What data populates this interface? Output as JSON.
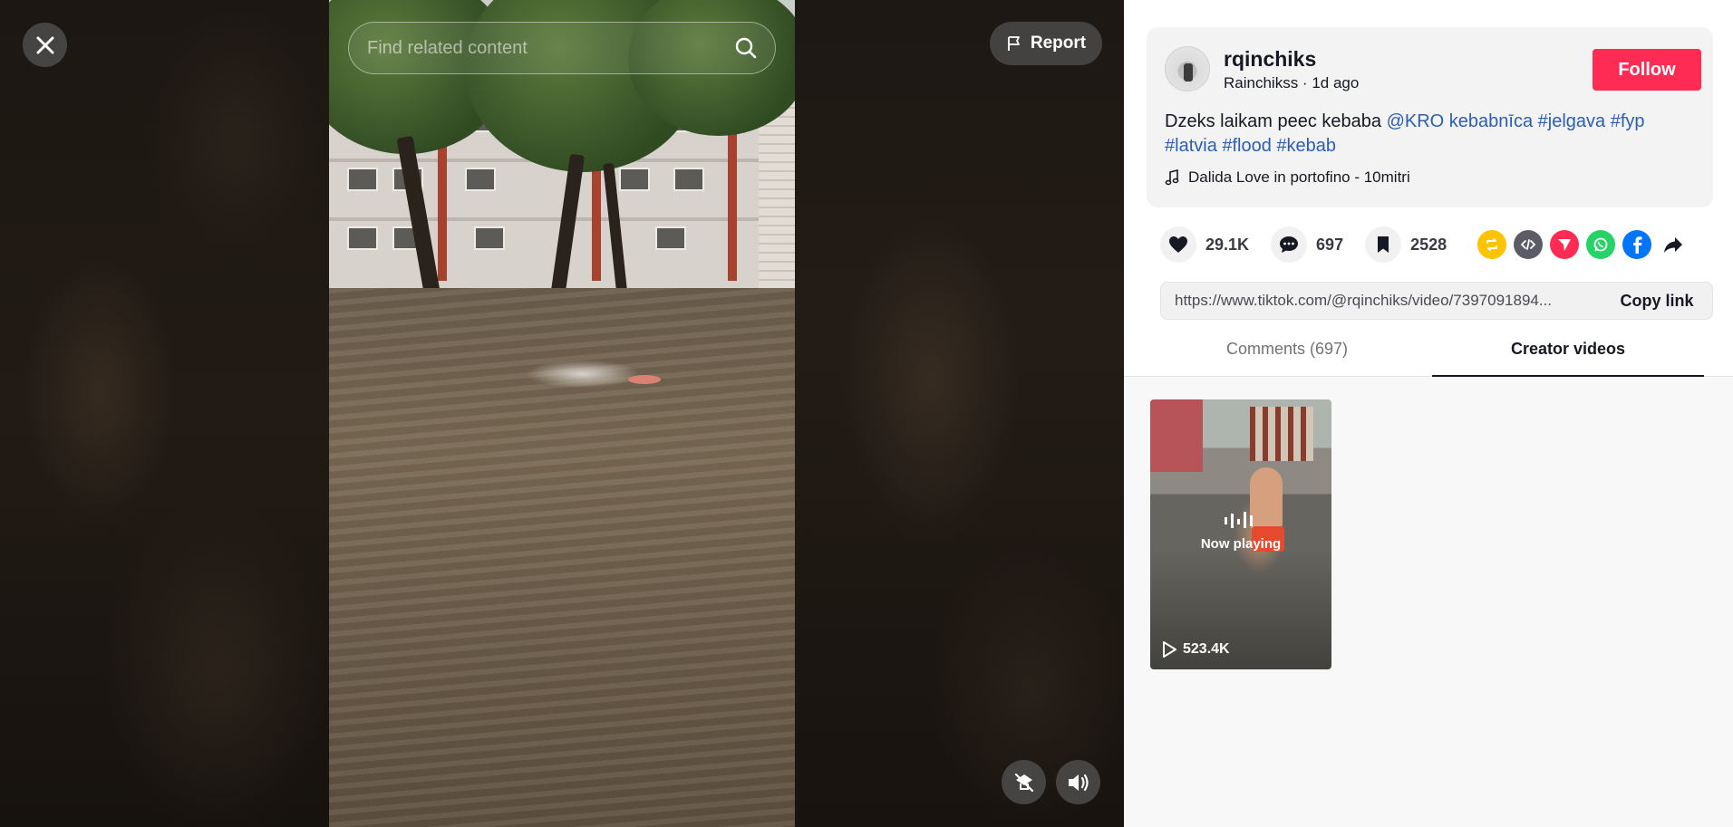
{
  "video": {
    "search_placeholder": "Find related content",
    "report_label": "Report"
  },
  "creator": {
    "username": "rqinchiks",
    "display_name": "Rainchikss",
    "separator": " · ",
    "posted": "1d ago",
    "follow_label": "Follow"
  },
  "caption": {
    "text": "Dzeks laikam peec kebaba ",
    "tags": [
      "@KRO kebabnīca",
      "#jelgava",
      "#fyp",
      "#latvia",
      "#flood",
      "#kebab"
    ]
  },
  "music": {
    "title": "Dalida Love in portofino - 10mitri"
  },
  "stats": {
    "likes": "29.1K",
    "comments": "697",
    "saves": "2528"
  },
  "share": {
    "icons": [
      "repost-icon",
      "embed-icon",
      "send-to-friends-icon",
      "whatsapp-icon",
      "facebook-icon",
      "share-arrow-icon"
    ],
    "colors": {
      "repost": "#ffc300",
      "embed": "#5c5c66",
      "send": "#fe2c55",
      "whatsapp": "#25d366",
      "facebook": "#0075fa"
    }
  },
  "link": {
    "url": "https://www.tiktok.com/@rqinchiks/video/7397091894...",
    "copy_label": "Copy link"
  },
  "tabs": {
    "comments": "Comments (697)",
    "creator_videos": "Creator videos"
  },
  "creator_videos": [
    {
      "status": "Now playing",
      "views": "523.4K"
    }
  ],
  "colors": {
    "accent": "#fe2c55",
    "hashtag": "#2b5db9"
  }
}
